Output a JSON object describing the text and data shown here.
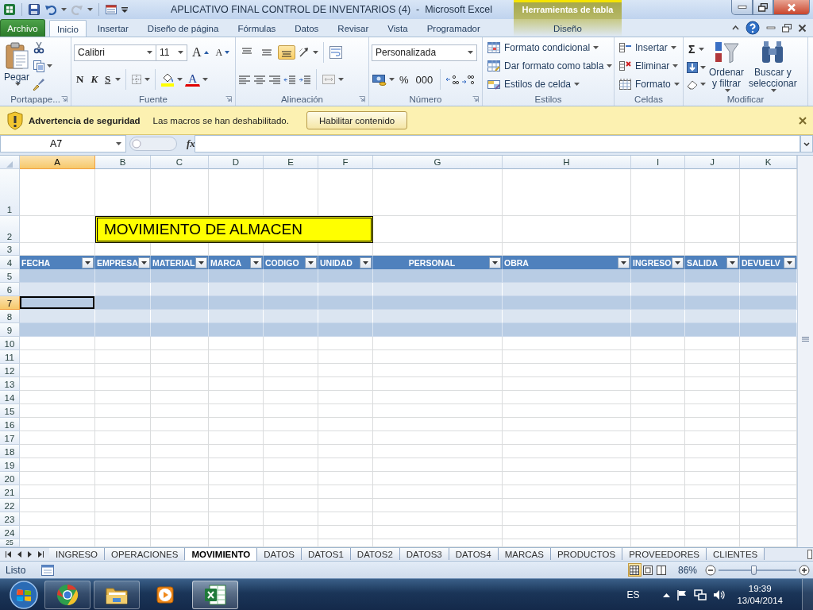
{
  "title_bar": {
    "title": "APLICATIVO FINAL CONTROL DE INVENTARIOS (4)  -  Microsoft Excel",
    "context_label": "Herramientas de tabla"
  },
  "ribbon_tabs": [
    {
      "label": "Archivo",
      "kind": "file",
      "selected": false
    },
    {
      "label": "Inicio",
      "kind": "tab",
      "selected": true
    },
    {
      "label": "Insertar",
      "kind": "tab",
      "selected": false
    },
    {
      "label": "Diseño de página",
      "kind": "tab",
      "selected": false
    },
    {
      "label": "Fórmulas",
      "kind": "tab",
      "selected": false
    },
    {
      "label": "Datos",
      "kind": "tab",
      "selected": false
    },
    {
      "label": "Revisar",
      "kind": "tab",
      "selected": false
    },
    {
      "label": "Vista",
      "kind": "tab",
      "selected": false
    },
    {
      "label": "Programador",
      "kind": "tab",
      "selected": false
    },
    {
      "label": "Diseño",
      "kind": "contextual",
      "selected": false
    }
  ],
  "ribbon": {
    "clipboard": {
      "paste": "Pegar",
      "group": "Portapape..."
    },
    "font": {
      "name": "Calibri",
      "size": "11",
      "grow": "A",
      "shrink": "A",
      "styles": [
        "N",
        "K",
        "S"
      ],
      "font_color": "A",
      "group": "Fuente"
    },
    "alignment": {
      "vertical": [
        {
          "selected": false
        },
        {
          "selected": false
        },
        {
          "selected": true
        }
      ],
      "group": "Alineación"
    },
    "number": {
      "format": "Personalizada",
      "percent": "%",
      "thousands": "000",
      "group": "Número"
    },
    "styles": {
      "items": [
        "Formato condicional",
        "Dar formato como tabla",
        "Estilos de celda"
      ],
      "group": "Estilos"
    },
    "cells": {
      "items": [
        "Insertar",
        "Eliminar",
        "Formato"
      ],
      "group": "Celdas"
    },
    "editing": {
      "sum": "Σ",
      "sort": [
        "Ordenar",
        "y filtrar"
      ],
      "find": [
        "Buscar y",
        "seleccionar"
      ],
      "group": "Modificar"
    }
  },
  "security_bar": {
    "title": "Advertencia de seguridad",
    "message": "Las macros se han deshabilitado.",
    "button": "Habilitar contenido"
  },
  "formula_bar": {
    "name_box": "A7",
    "fx": "fx"
  },
  "sheet": {
    "columns": [
      {
        "label": "A",
        "selected": true
      },
      {
        "label": "B",
        "selected": false
      },
      {
        "label": "C",
        "selected": false
      },
      {
        "label": "D",
        "selected": false
      },
      {
        "label": "E",
        "selected": false
      },
      {
        "label": "F",
        "selected": false
      },
      {
        "label": "G",
        "selected": false
      },
      {
        "label": "H",
        "selected": false
      },
      {
        "label": "I",
        "selected": false
      },
      {
        "label": "J",
        "selected": false
      },
      {
        "label": "K",
        "selected": false
      }
    ],
    "rows": [
      {
        "label": "1",
        "kind": "blank",
        "selected": false
      },
      {
        "label": "2",
        "kind": "title",
        "selected": false
      },
      {
        "label": "3",
        "kind": "blank",
        "selected": false
      },
      {
        "label": "4",
        "kind": "table-header",
        "selected": false
      },
      {
        "label": "5",
        "kind": "table-body",
        "selected": false
      },
      {
        "label": "6",
        "kind": "table-body",
        "selected": false
      },
      {
        "label": "7",
        "kind": "table-body",
        "selected": true
      },
      {
        "label": "8",
        "kind": "table-body",
        "selected": false
      },
      {
        "label": "9",
        "kind": "table-body",
        "selected": false
      },
      {
        "label": "10",
        "kind": "blank",
        "selected": false
      },
      {
        "label": "11",
        "kind": "blank",
        "selected": false
      },
      {
        "label": "12",
        "kind": "blank",
        "selected": false
      },
      {
        "label": "13",
        "kind": "blank",
        "selected": false
      },
      {
        "label": "14",
        "kind": "blank",
        "selected": false
      },
      {
        "label": "15",
        "kind": "blank",
        "selected": false
      },
      {
        "label": "16",
        "kind": "blank",
        "selected": false
      },
      {
        "label": "17",
        "kind": "blank",
        "selected": false
      },
      {
        "label": "18",
        "kind": "blank",
        "selected": false
      },
      {
        "label": "19",
        "kind": "blank",
        "selected": false
      },
      {
        "label": "20",
        "kind": "blank",
        "selected": false
      },
      {
        "label": "21",
        "kind": "blank",
        "selected": false
      },
      {
        "label": "22",
        "kind": "blank",
        "selected": false
      },
      {
        "label": "23",
        "kind": "blank",
        "selected": false
      },
      {
        "label": "24",
        "kind": "blank",
        "selected": false
      },
      {
        "label": "25",
        "kind": "blank",
        "selected": false
      }
    ],
    "title_cell": "MOVIMIENTO DE ALMACEN",
    "table_headers": [
      {
        "label": "FECHA",
        "centered": false
      },
      {
        "label": "EMPRESA",
        "centered": false
      },
      {
        "label": "MATERIAL",
        "centered": false
      },
      {
        "label": "MARCA",
        "centered": false
      },
      {
        "label": "CODIGO",
        "centered": false
      },
      {
        "label": "UNIDAD",
        "centered": false
      },
      {
        "label": "PERSONAL",
        "centered": true
      },
      {
        "label": "OBRA",
        "centered": false
      },
      {
        "label": "INGRESO",
        "centered": false
      },
      {
        "label": "SALIDA",
        "centered": false
      },
      {
        "label": "DEVUELV",
        "centered": false
      }
    ]
  },
  "sheet_tabs": [
    {
      "label": "INGRESO",
      "selected": false
    },
    {
      "label": "OPERACIONES",
      "selected": false
    },
    {
      "label": "MOVIMIENTO",
      "selected": true
    },
    {
      "label": "DATOS",
      "selected": false
    },
    {
      "label": "DATOS1",
      "selected": false
    },
    {
      "label": "DATOS2",
      "selected": false
    },
    {
      "label": "DATOS3",
      "selected": false
    },
    {
      "label": "DATOS4",
      "selected": false
    },
    {
      "label": "MARCAS",
      "selected": false
    },
    {
      "label": "PRODUCTOS",
      "selected": false
    },
    {
      "label": "PROVEEDORES",
      "selected": false
    },
    {
      "label": "CLIENTES",
      "selected": false
    }
  ],
  "status_bar": {
    "status": "Listo",
    "views": [
      {
        "selected": true
      },
      {
        "selected": false
      },
      {
        "selected": false
      }
    ],
    "zoom": "86%",
    "zoom_slider": {
      "level": 0.45
    }
  },
  "taskbar": {
    "apps": [
      {
        "kind": "browser",
        "selected": false
      },
      {
        "kind": "folder",
        "selected": false
      },
      {
        "kind": "media",
        "selected": false
      },
      {
        "kind": "spreadsheet",
        "selected": true
      }
    ],
    "language": "ES",
    "time": "19:39",
    "date": "13/04/2014"
  }
}
